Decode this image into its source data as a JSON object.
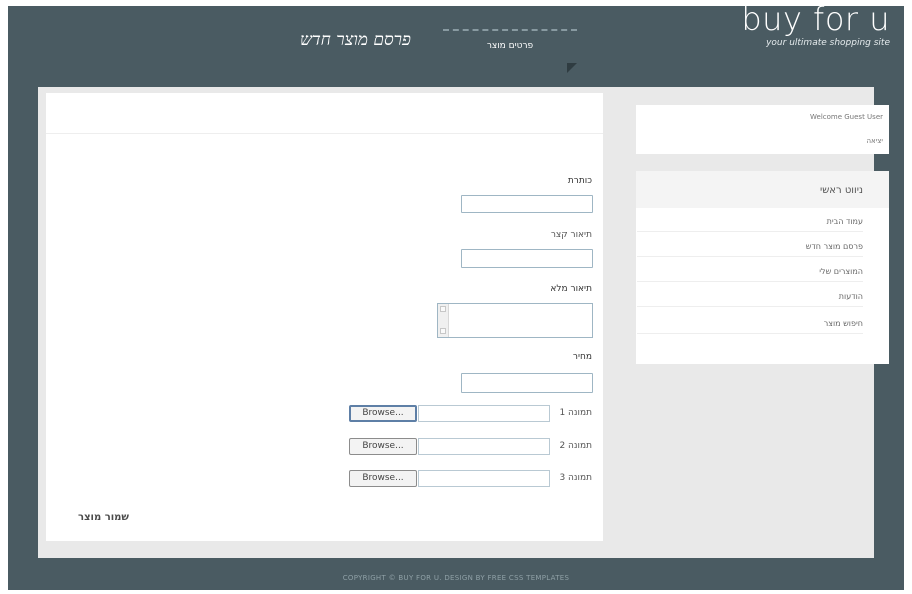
{
  "header": {
    "title": "פרסם מוצר חדש",
    "logo_text": "buy for u",
    "logo_tagline": "your ultimate shopping site"
  },
  "form": {
    "tab_label": "פרטים מוצר",
    "fields": [
      {
        "label": "כותרת",
        "value": ""
      },
      {
        "label": "תיאור קצר",
        "value": ""
      },
      {
        "label": "תיאור מלא",
        "value": ""
      },
      {
        "label": "מחיר",
        "value": ""
      }
    ],
    "files": [
      {
        "label": "תמונה 1",
        "button": "Browse..."
      },
      {
        "label": "תמונה 2",
        "button": "Browse..."
      },
      {
        "label": "תמונה 3",
        "button": "Browse..."
      }
    ],
    "submit_label": "שמור מוצר"
  },
  "sidebar": {
    "welcome": "Welcome Guest User",
    "logout": "יציאה",
    "menu_title": "ניווט ראשי",
    "menu_items": [
      "עמוד הבית",
      "פרסם מוצר חדש",
      "המוצרים שלי",
      "הודעות",
      "חיפוש מוצר"
    ]
  },
  "footer": {
    "text": "COPYRIGHT © BUY FOR U. DESIGN BY FREE CSS TEMPLATES"
  },
  "colors": {
    "header_bg": "#4a5b62",
    "content_bg": "#e9e9e9",
    "input_border": "#9fb6c4"
  }
}
